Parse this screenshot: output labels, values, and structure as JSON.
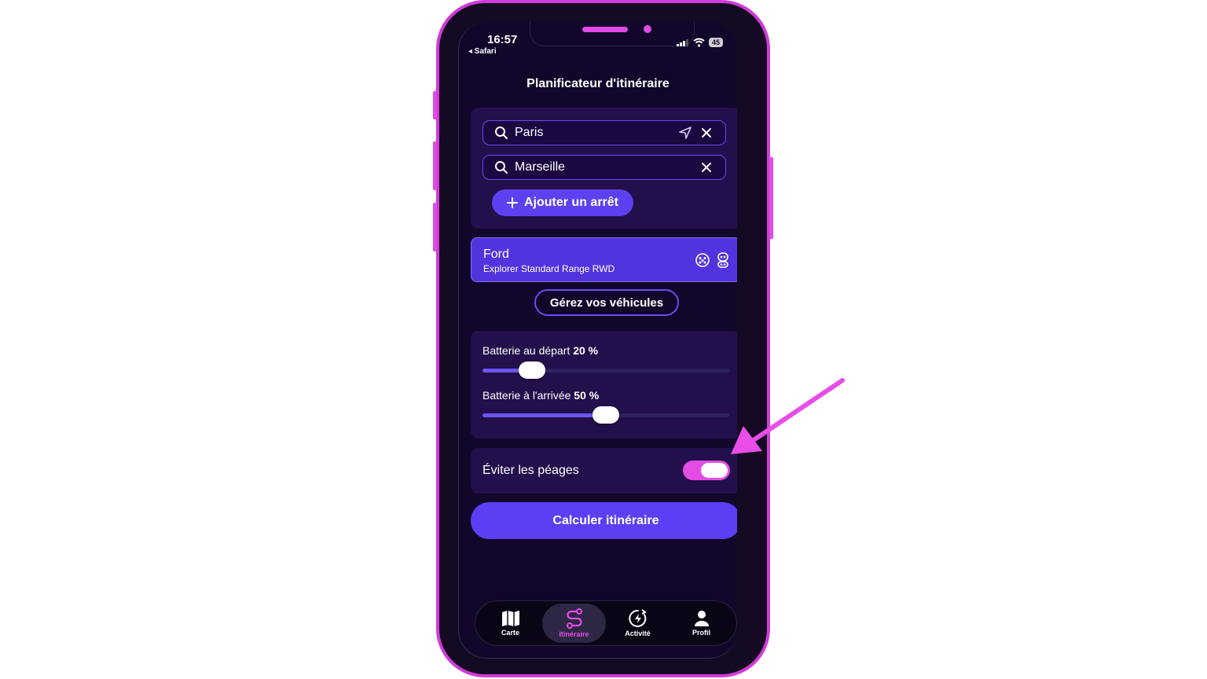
{
  "status": {
    "time": "16:57",
    "back": "◂ Safari",
    "battery": "45"
  },
  "page": {
    "title": "Planificateur d'itinéraire"
  },
  "route": {
    "origin": "Paris",
    "destination": "Marseille",
    "add_stop_label": "Ajouter un arrêt"
  },
  "vehicle": {
    "make": "Ford",
    "model": "Explorer Standard Range RWD",
    "manage_label": "Gérez vos véhicules"
  },
  "battery": {
    "start_label": "Batterie au départ",
    "start_value": "20 %",
    "start_fraction": 0.2,
    "end_label": "Batterie à l'arrivée",
    "end_value": "50 %",
    "end_fraction": 0.5
  },
  "tolls": {
    "label": "Éviter les péages",
    "enabled": true
  },
  "calculate_label": "Calculer itinéraire",
  "tabs": [
    {
      "label": "Carte",
      "icon": "map-icon"
    },
    {
      "label": "Itinéraire",
      "icon": "route-icon",
      "active": true
    },
    {
      "label": "Activité",
      "icon": "activity-bolt-icon"
    },
    {
      "label": "Profil",
      "icon": "person-icon"
    }
  ],
  "colors": {
    "accent": "#5b3ff5",
    "highlight": "#e44ce6",
    "background": "#12062a",
    "card": "#220f4b"
  }
}
